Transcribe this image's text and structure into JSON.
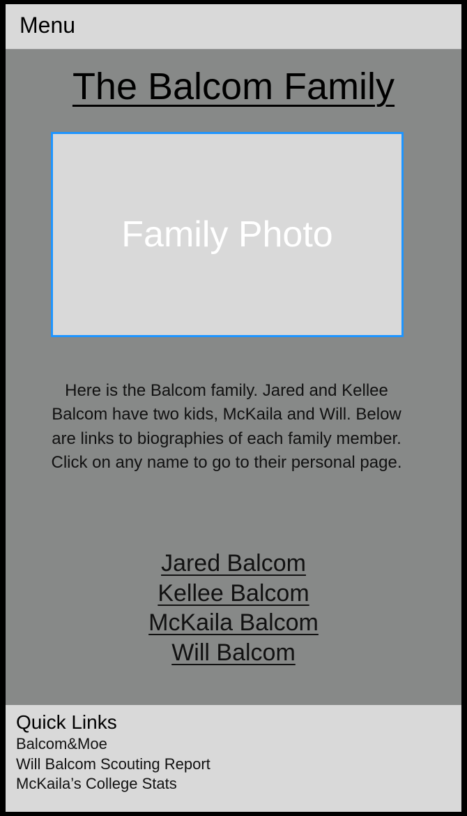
{
  "header": {
    "menu_label": "Menu"
  },
  "main": {
    "title": "The Balcom Family",
    "photo_label": "Family Photo",
    "description": "Here is the Balcom family. Jared and Kellee Balcom have two kids, McKaila and Will. Below are links to biographies of each family member. Click on any name to go to their personal page.",
    "member_links": [
      "Jared Balcom",
      "Kellee Balcom",
      "McKaila Balcom",
      "Will Balcom"
    ]
  },
  "footer": {
    "title": "Quick Links",
    "links": [
      "Balcom&Moe",
      "Will Balcom Scouting Report",
      "McKaila’s College Stats"
    ]
  },
  "colors": {
    "photo_border": "#1e95ff",
    "main_bg": "#878988",
    "panel_bg": "#d9d9d9"
  }
}
